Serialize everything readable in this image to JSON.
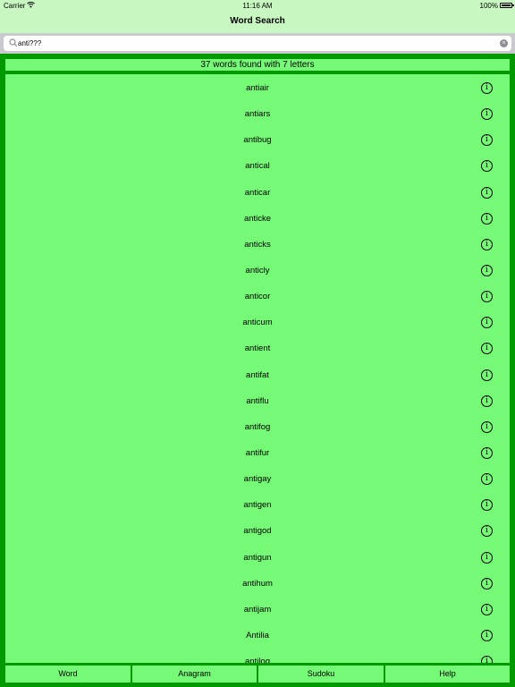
{
  "status_bar": {
    "carrier": "Carrier",
    "time": "11:16 AM",
    "battery": "100%"
  },
  "nav": {
    "title": "Word Search"
  },
  "search": {
    "value": "anti???"
  },
  "results": {
    "summary": "37 words found with 7 letters",
    "words": [
      "antiair",
      "antiars",
      "antibug",
      "antical",
      "anticar",
      "anticke",
      "anticks",
      "anticly",
      "anticor",
      "anticum",
      "antient",
      "antifat",
      "antiflu",
      "antifog",
      "antifur",
      "antigay",
      "antigen",
      "antigod",
      "antigun",
      "antihum",
      "antijam",
      "Antilia",
      "antilog"
    ]
  },
  "tabs": {
    "word": "Word",
    "anagram": "Anagram",
    "sudoku": "Sudoku",
    "help": "Help"
  },
  "colors": {
    "frame_green": "#009a00",
    "cell_green": "#76f976",
    "nav_green": "#c9f7c2"
  }
}
